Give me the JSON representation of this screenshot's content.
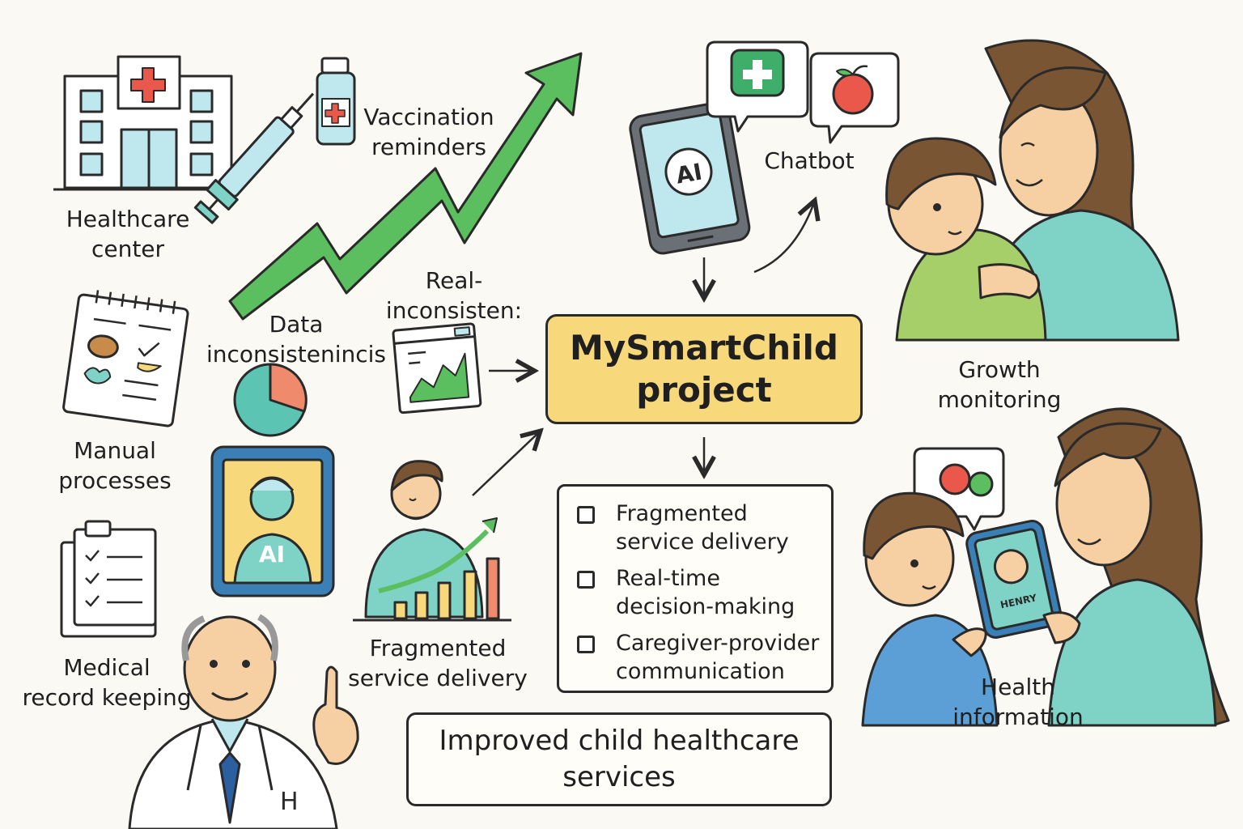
{
  "project": {
    "line1": "MySmartChild",
    "line2": "project"
  },
  "labels": {
    "healthcare_center": [
      "Healthcare",
      "center"
    ],
    "vaccination_reminders": [
      "Vaccination",
      "reminders"
    ],
    "manual_processes": [
      "Manual",
      "processes"
    ],
    "medical_record_keeping": [
      "Medical",
      "record keeping"
    ],
    "data_inconsistencies": [
      "Data",
      "inconsistenincis"
    ],
    "real_inconsistent": [
      "Real-",
      "inconsisten:"
    ],
    "fragmented_service_delivery": [
      "Fragmented",
      "service delivery"
    ],
    "chatbot": "Chatbot",
    "growth_monitoring": [
      "Growth",
      "monitoring"
    ],
    "health_information": [
      "Health",
      "information"
    ]
  },
  "checklist": [
    {
      "lines": [
        "Fragmented",
        "service delivery"
      ]
    },
    {
      "lines": [
        "Real-time",
        "decision-making"
      ]
    },
    {
      "lines": [
        "Caregiver-provider",
        "communication"
      ]
    }
  ],
  "outcome": [
    "Improved child healthcare",
    "services"
  ],
  "icon_text": {
    "ai_phone": "AI",
    "ai_tablet": "AI",
    "child_phone_name": "HENRY"
  },
  "colors": {
    "project_fill": "#f7d97c",
    "green_arrow": "#5bbf5f",
    "teal": "#7fd3c6",
    "light_blue": "#bfe8ee",
    "red_cross": "#e9584a",
    "skin": "#f6cfa3",
    "hair": "#7a5533",
    "child_shirt": "#a6cf6a"
  }
}
